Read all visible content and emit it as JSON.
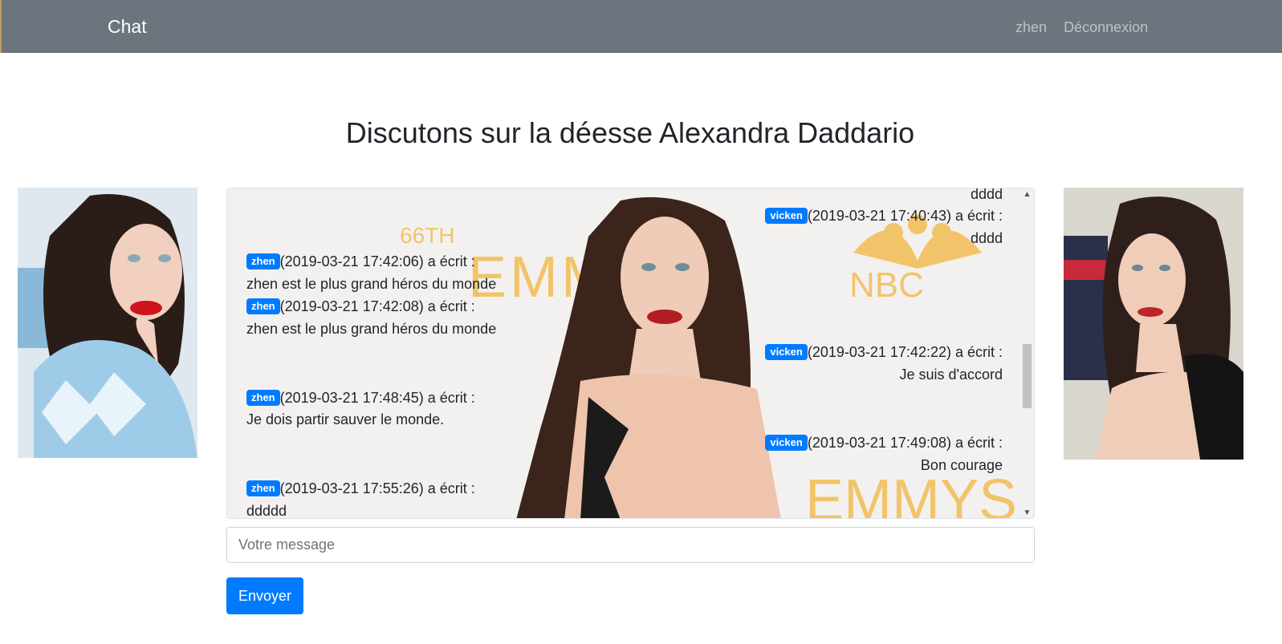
{
  "navbar": {
    "brand": "Chat",
    "links": [
      "zhen",
      "Déconnexion"
    ]
  },
  "page_title": "Discutons sur la déesse Alexandra Daddario",
  "chat": {
    "badge_color": "#007bff",
    "background_text": [
      "66TH",
      "EMMYS",
      "NBC",
      "EMMYS"
    ],
    "messages": [
      {
        "side": "right",
        "author": "vicken",
        "header": "",
        "text": "dddd"
      },
      {
        "side": "right",
        "author": "vicken",
        "header": "(2019-03-21 17:40:43) a écrit :",
        "text": "dddd"
      },
      {
        "side": "left",
        "author": "zhen",
        "header": "(2019-03-21 17:42:06) a écrit :",
        "text": "zhen est le plus grand héros du monde"
      },
      {
        "side": "left",
        "author": "zhen",
        "header": "(2019-03-21 17:42:08) a écrit :",
        "text": "zhen est le plus grand héros du monde"
      },
      {
        "side": "right",
        "author": "vicken",
        "header": "(2019-03-21 17:42:22) a écrit :",
        "text": "Je suis d'accord"
      },
      {
        "side": "left",
        "author": "zhen",
        "header": "(2019-03-21 17:48:45) a écrit :",
        "text": "Je dois partir sauver le monde."
      },
      {
        "side": "right",
        "author": "vicken",
        "header": "(2019-03-21 17:49:08) a écrit :",
        "text": "Bon courage"
      },
      {
        "side": "left",
        "author": "zhen",
        "header": "(2019-03-21 17:55:26) a écrit :",
        "text": "ddddd"
      }
    ]
  },
  "input": {
    "placeholder": "Votre message",
    "value": ""
  },
  "send_button": "Envoyer"
}
